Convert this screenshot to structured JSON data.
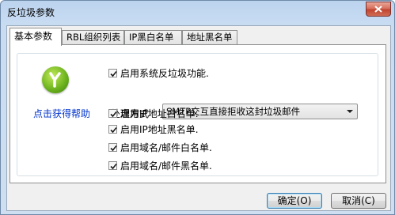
{
  "window": {
    "title": "反垃圾参数"
  },
  "tabs": [
    {
      "label": "基本参数",
      "active": true
    },
    {
      "label": "RBL组织列表",
      "active": false
    },
    {
      "label": "IP黑白名单",
      "active": false
    },
    {
      "label": "地址黑名单",
      "active": false
    }
  ],
  "help": {
    "label": "点击获得帮助"
  },
  "options": {
    "enable_antispam": {
      "label": "启用系统反垃圾功能.",
      "checked": true
    },
    "process_label": "处理方式",
    "process_select": {
      "value": "SMTP交互直接拒收这封垃圾邮件"
    },
    "ip_whitelist": {
      "label": "启用IP地址白名单.",
      "checked": true
    },
    "ip_blacklist": {
      "label": "启用IP地址黑名单.",
      "checked": true
    },
    "domain_whitelist": {
      "label": "启用域名/邮件白名单.",
      "checked": true
    },
    "domain_blacklist": {
      "label": "启用域名/邮件黑名单.",
      "checked": true
    }
  },
  "buttons": {
    "ok": "确定(O)",
    "cancel": "取消(C)"
  },
  "colors": {
    "title_bg": "#c4daf2",
    "close_red": "#c1442f",
    "link_blue": "#0033cc",
    "logo_green": "#6fb51f"
  }
}
